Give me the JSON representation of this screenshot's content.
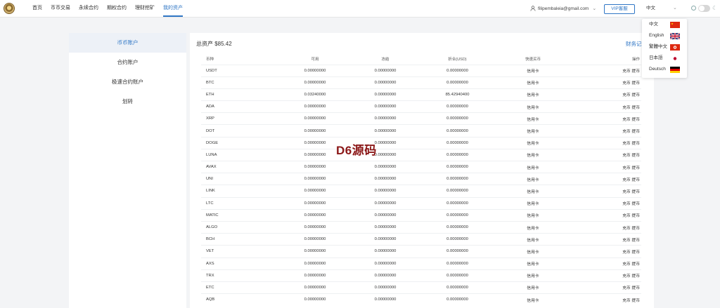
{
  "nav": {
    "items": [
      "首页",
      "币币交易",
      "永续合约",
      "期权合约",
      "理财挖矿",
      "我的资产"
    ],
    "active": 5
  },
  "user": {
    "email": "filipembaleia@gmail.com"
  },
  "vip_label": "VIP客服",
  "language": {
    "current": "中文",
    "options": [
      "中文",
      "English",
      "繁體中文",
      "日本語",
      "Deutsch"
    ]
  },
  "sidebar": {
    "items": [
      "币币账户",
      "合约账户",
      "极速合约账户",
      "划转"
    ],
    "active": 0
  },
  "summary": {
    "total": "总资产 $85.42",
    "records_link": "财务记"
  },
  "table": {
    "headers": [
      "币种",
      "可用",
      "冻结",
      "折合(USD)",
      "快速买币",
      "操作"
    ],
    "rows": [
      [
        "USDT",
        "0.00000000",
        "0.00000000",
        "0.00000000",
        "信用卡",
        "充币 提币"
      ],
      [
        "BTC",
        "0.00000000",
        "0.00000000",
        "0.00000000",
        "信用卡",
        "充币 提币"
      ],
      [
        "ETH",
        "0.03240000",
        "0.00000000",
        "85.42940400",
        "信用卡",
        "充币 提币"
      ],
      [
        "ADA",
        "0.00000000",
        "0.00000000",
        "0.00000000",
        "信用卡",
        "充币 提币"
      ],
      [
        "XRP",
        "0.00000000",
        "0.00000000",
        "0.00000000",
        "信用卡",
        "充币 提币"
      ],
      [
        "DOT",
        "0.00000000",
        "0.00000000",
        "0.00000000",
        "信用卡",
        "充币 提币"
      ],
      [
        "DOGE",
        "0.00000000",
        "0.00000000",
        "0.00000000",
        "信用卡",
        "充币 提币"
      ],
      [
        "LUNA",
        "0.00000000",
        "0.00000000",
        "0.00000000",
        "信用卡",
        "充币 提币"
      ],
      [
        "AVAX",
        "0.00000000",
        "0.00000000",
        "0.00000000",
        "信用卡",
        "充币 提币"
      ],
      [
        "UNI",
        "0.00000000",
        "0.00000000",
        "0.00000000",
        "信用卡",
        "充币 提币"
      ],
      [
        "LINK",
        "0.00000000",
        "0.00000000",
        "0.00000000",
        "信用卡",
        "充币 提币"
      ],
      [
        "LTC",
        "0.00000000",
        "0.00000000",
        "0.00000000",
        "信用卡",
        "充币 提币"
      ],
      [
        "MATIC",
        "0.00000000",
        "0.00000000",
        "0.00000000",
        "信用卡",
        "充币 提币"
      ],
      [
        "ALGO",
        "0.00000000",
        "0.00000000",
        "0.00000000",
        "信用卡",
        "充币 提币"
      ],
      [
        "BCH",
        "0.00000000",
        "0.00000000",
        "0.00000000",
        "信用卡",
        "充币 提币"
      ],
      [
        "VET",
        "0.00000000",
        "0.00000000",
        "0.00000000",
        "信用卡",
        "充币 提币"
      ],
      [
        "AXS",
        "0.00000000",
        "0.00000000",
        "0.00000000",
        "信用卡",
        "充币 提币"
      ],
      [
        "TRX",
        "0.00000000",
        "0.00000000",
        "0.00000000",
        "信用卡",
        "充币 提币"
      ],
      [
        "ETC",
        "0.00000000",
        "0.00000000",
        "0.00000000",
        "信用卡",
        "充币 提币"
      ],
      [
        "AQB",
        "0.00000000",
        "0.00000000",
        "0.00000000",
        "信用卡",
        "充币 提币"
      ]
    ],
    "active_op_rows": 3
  },
  "watermark": "D6源码",
  "colors": {
    "accent": "#2f76c5",
    "sidebar_active_bg": "#edf1f7",
    "watermark": "#8b1717"
  }
}
